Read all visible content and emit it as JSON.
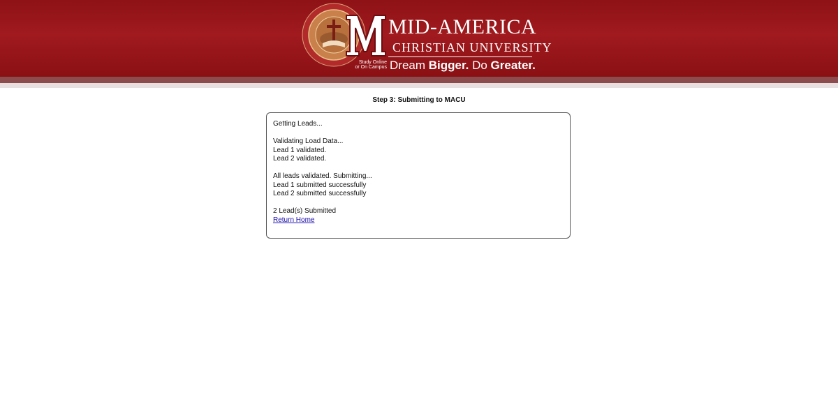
{
  "header": {
    "brand_name": "MID-AMERICA",
    "brand_sub": "CHRISTIAN UNIVERSITY",
    "study_line1": "Study Online",
    "study_line2": "or On Campus",
    "tagline_1": "Dream ",
    "tagline_2": "Bigger.",
    "tagline_3": " Do ",
    "tagline_4": "Greater.",
    "seal_text": "MID-AMERICA CHRISTIAN",
    "colors": {
      "header_red": "#8e1216",
      "band": "#8c4c4e"
    }
  },
  "main": {
    "step_title": "Step 3: Submitting to MACU",
    "log": {
      "getting": "Getting Leads...",
      "validating": "Validating Load Data...",
      "lead1_valid": "Lead 1 validated.",
      "lead2_valid": "Lead 2 validated.",
      "all_valid": "All leads validated. Submitting...",
      "lead1_submitted": "Lead 1 submitted successfully",
      "lead2_submitted": "Lead 2 submitted successfully",
      "count": "2 Lead(s) Submitted",
      "return_link": "Return Home"
    }
  }
}
